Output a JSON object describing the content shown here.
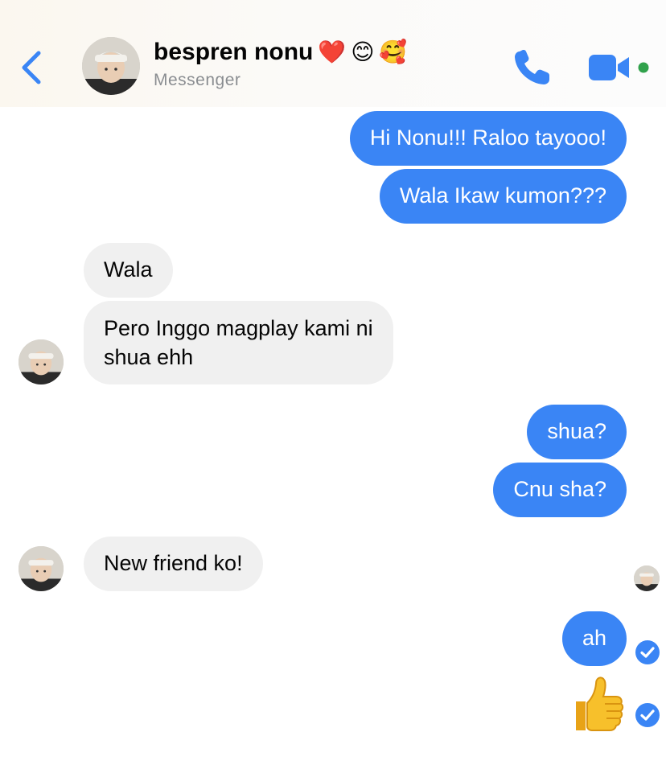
{
  "header": {
    "contact_name": "bespren nonu",
    "name_emojis": [
      "❤️",
      "😊",
      "🥰"
    ],
    "subtitle": "Messenger",
    "accent_color": "#3a85f5",
    "online_color": "#31a24c",
    "icons": [
      "chevron-left-icon",
      "phone-icon",
      "video-camera-icon"
    ]
  },
  "messages": [
    {
      "direction": "outgoing",
      "text": "Hi Nonu!!! Raloo tayooo!"
    },
    {
      "direction": "outgoing",
      "text": "Wala Ikaw kumon???"
    },
    {
      "direction": "incoming",
      "text": "Wala"
    },
    {
      "direction": "incoming",
      "lines": [
        "Pero Inggo magplay kami ni",
        "shua ehh"
      ]
    },
    {
      "direction": "outgoing",
      "text": "shua?"
    },
    {
      "direction": "outgoing",
      "text": "Cnu sha?"
    },
    {
      "direction": "incoming",
      "text": "New friend ko!"
    },
    {
      "direction": "outgoing",
      "text": "ah",
      "status": "delivered"
    },
    {
      "direction": "outgoing",
      "emoji": "👍",
      "status": "delivered"
    }
  ],
  "colors": {
    "outgoing_bubble": "#3a85f5",
    "incoming_bubble": "#f0f0f0",
    "incoming_text": "#050505"
  }
}
